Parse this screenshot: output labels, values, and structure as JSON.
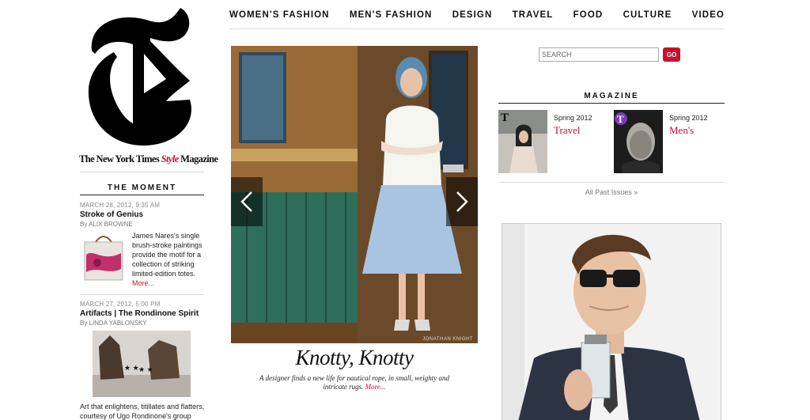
{
  "masthead": {
    "part1": "The New York Times ",
    "part2": "Style",
    "part3": " Magazine"
  },
  "nav": {
    "items": [
      "WOMEN'S FASHION",
      "MEN'S FASHION",
      "DESIGN",
      "TRAVEL",
      "FOOD",
      "CULTURE",
      "VIDEO"
    ]
  },
  "moment": {
    "heading": "THE MOMENT",
    "stories": [
      {
        "date": "MARCH 28, 2012, 9:35 AM",
        "title": "Stroke of Genius",
        "byline": "By ALIX BROWNE",
        "blurb": "James Nares's single brush-stroke paintings provide the motif for a collection of striking limited-edition totes.",
        "more": "More..."
      },
      {
        "date": "MARCH 27, 2012, 5:00 PM",
        "title": "Artifacts | The Rondinone Spirit",
        "byline": "By LINDA YABLONSKY",
        "blurb": "Art that enlightens, titillates and flatters, courtesy of Ugo Rondinone's group"
      }
    ]
  },
  "hero": {
    "title": "Knotty, Knotty",
    "dek": "A designer finds a new life for nautical rope, in small, weighty and intricate rugs.",
    "more": "More...",
    "credit": "JONATHAN KNIGHT"
  },
  "search": {
    "placeholder": "SEARCH",
    "button": "GO"
  },
  "magazine": {
    "heading": "MAGAZINE",
    "issues": [
      {
        "season": "Spring 2012",
        "name": "Travel"
      },
      {
        "season": "Spring 2012",
        "name": "Men's"
      }
    ],
    "past_issues": "All Past Issues »"
  },
  "colors": {
    "accent": "#c8102e",
    "text": "#111111",
    "muted": "#888888"
  }
}
